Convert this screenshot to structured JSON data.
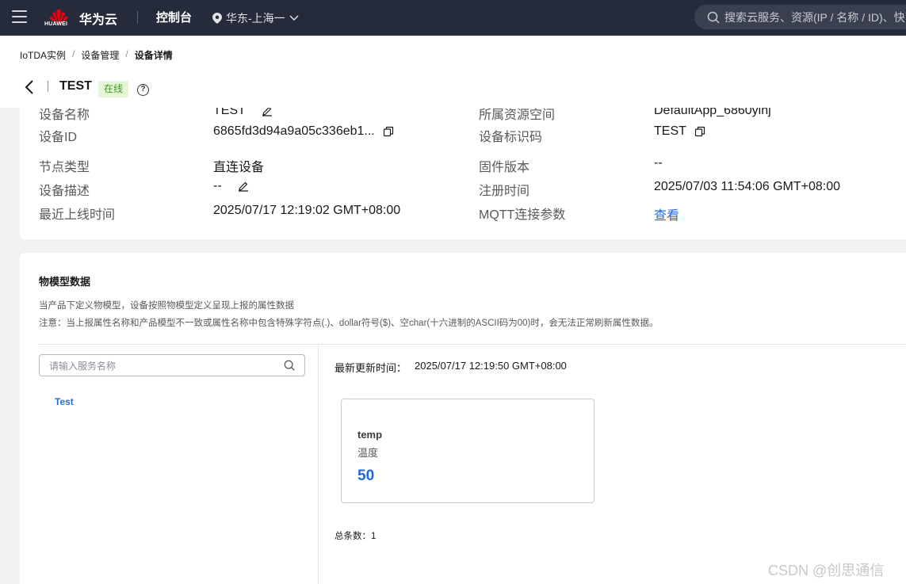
{
  "topbar": {
    "brand_logo_text": "HUAWEI",
    "brand_name": "华为云",
    "console": "控制台",
    "region": "华东-上海一",
    "search_placeholder": "搜索云服务、资源(IP / 名称 / ID)、快"
  },
  "breadcrumb": [
    "IoTDA实例",
    "/",
    "设备管理",
    "/",
    "设备详情"
  ],
  "device_header": {
    "title": "TEST",
    "status": "在线"
  },
  "device_info": {
    "name_label": "设备名称",
    "name_value": "TEST",
    "space_label": "所属资源空间",
    "space_value": "DefaultApp_6860yihj",
    "id_label": "设备ID",
    "id_value": "6865fd3d94a9a05c336eb1...",
    "identifier_label": "设备标识码",
    "identifier_value": "TEST",
    "node_label": "节点类型",
    "node_value": "直连设备",
    "firmware_label": "固件版本",
    "firmware_value": "--",
    "desc_label": "设备描述",
    "desc_value": "--",
    "register_label": "注册时间",
    "register_value": "2025/07/03 11:54:06 GMT+08:00",
    "online_label": "最近上线时间",
    "online_value": "2025/07/17 12:19:02 GMT+08:00",
    "mqtt_label": "MQTT连接参数",
    "mqtt_link": "查看"
  },
  "model": {
    "title": "物模型数据",
    "desc1": "当产品下定义物模型，设备按照物模型定义呈现上报的属性数据",
    "desc2": "注意：当上报属性名称和产品模型不一致或属性名称中包含特殊字符点(.)、dollar符号($)、空char(十六进制的ASCII码为00)时，会无法正常刷新属性数据。",
    "search_placeholder": "请输入服务名称",
    "services": [
      "Test"
    ],
    "updated_label": "最新更新时间：",
    "updated_value": "2025/07/17 12:19:50 GMT+08:00",
    "property": {
      "name": "temp",
      "cn": "温度",
      "value": "50"
    },
    "total": "总条数：1"
  },
  "watermark": "CSDN @创思通信",
  "colors": {
    "topbar": "#252b3a",
    "accent": "#1f6ad8",
    "online_bg": "#e6f4d8",
    "online_text": "#3f9b1f"
  }
}
